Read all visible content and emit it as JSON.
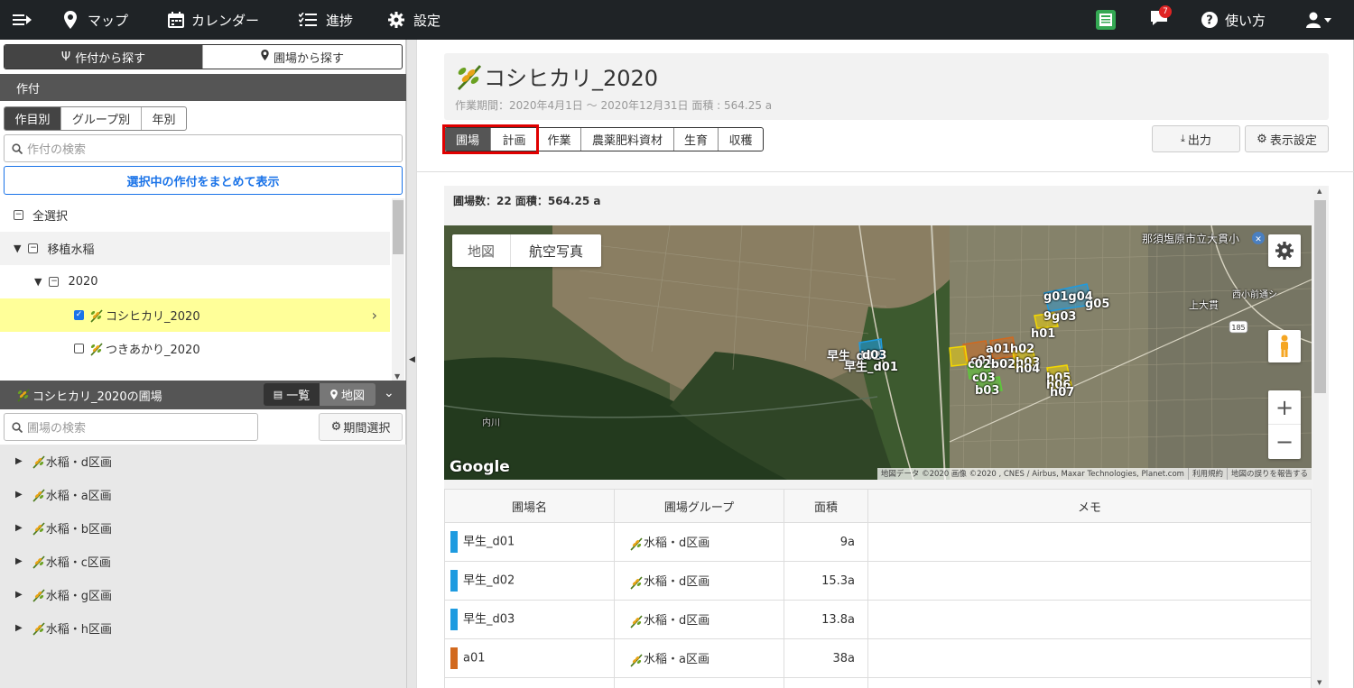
{
  "nav": {
    "map": "マップ",
    "calendar": "カレンダー",
    "progress": "進捗",
    "settings": "設定",
    "notifications_count": "7",
    "help": "使い方"
  },
  "left": {
    "search_tabs": [
      "作付から探す",
      "圃場から探す"
    ],
    "crop_header": "作付",
    "view_tabs": [
      "作目別",
      "グループ別",
      "年別"
    ],
    "crop_search_placeholder": "作付の検索",
    "show_all_button": "選択中の作付をまとめて表示",
    "tree": {
      "select_all": "全選択",
      "category": "移植水稲",
      "year": "2020",
      "items": [
        {
          "label": "コシヒカリ_2020",
          "checked": true
        },
        {
          "label": "つきあかり_2020",
          "checked": false
        }
      ]
    },
    "field_panel": {
      "title": "コシヒカリ_2020の圃場",
      "list_label": "一覧",
      "map_label": "地図",
      "search_placeholder": "圃場の検索",
      "period_button": "期間選択",
      "groups": [
        "水稲・d区画",
        "水稲・a区画",
        "水稲・b区画",
        "水稲・c区画",
        "水稲・g区画",
        "水稲・h区画"
      ]
    }
  },
  "main": {
    "title": "コシヒカリ_2020",
    "subtitle": "作業期間：2020年4月1日 〜 2020年12月31日  面積 : 564.25 a",
    "tabs": [
      "圃場",
      "計画",
      "作業",
      "農薬肥料資材",
      "生育",
      "収穫"
    ],
    "export_button": "出力",
    "display_settings_button": "表示設定",
    "summary": "圃場数：22 面積：564.25 a",
    "map": {
      "type_buttons": [
        "地図",
        "航空写真"
      ],
      "place_label": "那須塩原市立大貫小",
      "area_label": "上大貫",
      "area_label2": "西小前通シ",
      "route": "185",
      "river": "内川",
      "attribution": "地図データ ©2020 画像 ©2020 , CNES / Airbus, Maxar Technologies, Planet.com",
      "terms": "利用規約",
      "report": "地図の誤りを報告する",
      "google": "Google",
      "field_labels": [
        "g01g04",
        "g05",
        "9g03",
        "h01",
        "a01h02",
        "c01",
        "c02b02",
        "h03",
        "c03",
        "h04",
        "b03",
        "h05",
        "h06",
        "h07",
        "早生_d02",
        "早生_d01",
        "d03"
      ]
    },
    "table": {
      "headers": [
        "圃場名",
        "圃場グループ",
        "面積",
        "メモ"
      ],
      "rows": [
        {
          "name": "早生_d01",
          "group": "水稲・d区画",
          "area": "9a",
          "memo": "",
          "color": "#1e9be0"
        },
        {
          "name": "早生_d02",
          "group": "水稲・d区画",
          "area": "15.3a",
          "memo": "",
          "color": "#1e9be0"
        },
        {
          "name": "早生_d03",
          "group": "水稲・d区画",
          "area": "13.8a",
          "memo": "",
          "color": "#1e9be0"
        },
        {
          "name": "a01",
          "group": "水稲・a区画",
          "area": "38a",
          "memo": "",
          "color": "#d2691e"
        }
      ]
    }
  },
  "colors": {
    "topbar": "#1f2326",
    "highlight_row": "#ffff99",
    "accent_blue": "#1a73e8",
    "red_outline": "#e00000"
  }
}
